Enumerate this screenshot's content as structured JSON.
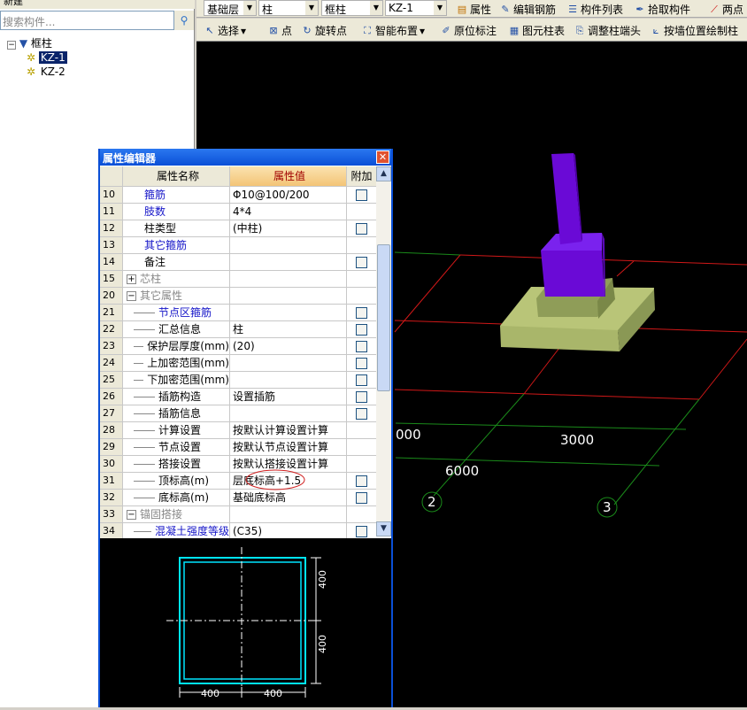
{
  "left_panel": {
    "toolbar_new": "新建",
    "search_placeholder": "搜索构件...",
    "tree": {
      "root": "框柱",
      "children": [
        "KZ-1",
        "KZ-2"
      ],
      "selected": "KZ-1"
    }
  },
  "toolbar1": {
    "floor": "基础层",
    "category": "柱",
    "type": "框柱",
    "component": "KZ-1",
    "buttons": [
      "属性",
      "编辑钢筋",
      "构件列表",
      "拾取构件",
      "两点"
    ]
  },
  "toolbar2": {
    "buttons": [
      "选择",
      "点",
      "旋转点",
      "智能布置",
      "原位标注",
      "图元柱表",
      "调整柱端头",
      "按墙位置绘制柱"
    ]
  },
  "scene": {
    "labels": [
      "000",
      "3000",
      "6000"
    ],
    "axes": [
      "2",
      "3"
    ],
    "column_color": "#6a0ad6",
    "footing_color": "#a9b66a"
  },
  "editor": {
    "title": "属性编辑器",
    "headers": [
      "属性名称",
      "属性值",
      "附加"
    ],
    "rows": [
      {
        "n": "10",
        "name": "箍筋",
        "value": "Φ10@100/200",
        "style": "blue",
        "cb": true
      },
      {
        "n": "11",
        "name": "肢数",
        "value": "4*4",
        "style": "blue",
        "cb": false
      },
      {
        "n": "12",
        "name": "柱类型",
        "value": "(中柱)",
        "style": "",
        "cb": true
      },
      {
        "n": "13",
        "name": "其它箍筋",
        "value": "",
        "style": "blue",
        "cb": false
      },
      {
        "n": "14",
        "name": "备注",
        "value": "",
        "style": "",
        "cb": true
      },
      {
        "n": "15",
        "name": "芯柱",
        "value": "",
        "style": "gray",
        "exp": "+",
        "cb": false
      },
      {
        "n": "20",
        "name": "其它属性",
        "value": "",
        "style": "gray",
        "exp": "−",
        "cb": false
      },
      {
        "n": "21",
        "name": "节点区箍筋",
        "value": "",
        "style": "blue",
        "child": true,
        "cb": true
      },
      {
        "n": "22",
        "name": "汇总信息",
        "value": "柱",
        "style": "",
        "child": true,
        "cb": true
      },
      {
        "n": "23",
        "name": "保护层厚度(mm)",
        "value": "(20)",
        "style": "",
        "child": true,
        "cb": true
      },
      {
        "n": "24",
        "name": "上加密范围(mm)",
        "value": "",
        "style": "",
        "child": true,
        "cb": true
      },
      {
        "n": "25",
        "name": "下加密范围(mm)",
        "value": "",
        "style": "",
        "child": true,
        "cb": true
      },
      {
        "n": "26",
        "name": "插筋构造",
        "value": "设置插筋",
        "style": "",
        "child": true,
        "cb": true
      },
      {
        "n": "27",
        "name": "插筋信息",
        "value": "",
        "style": "",
        "child": true,
        "cb": true
      },
      {
        "n": "28",
        "name": "计算设置",
        "value": "按默认计算设置计算",
        "style": "",
        "child": true,
        "cb": false
      },
      {
        "n": "29",
        "name": "节点设置",
        "value": "按默认节点设置计算",
        "style": "",
        "child": true,
        "cb": false
      },
      {
        "n": "30",
        "name": "搭接设置",
        "value": "按默认搭接设置计算",
        "style": "",
        "child": true,
        "cb": false
      },
      {
        "n": "31",
        "name": "顶标高(m)",
        "value": "层底标高+1.5",
        "style": "",
        "child": true,
        "cb": true
      },
      {
        "n": "32",
        "name": "底标高(m)",
        "value": "基础底标高",
        "style": "",
        "child": true,
        "cb": true
      },
      {
        "n": "33",
        "name": "锚固搭接",
        "value": "",
        "style": "gray",
        "exp": "−",
        "cb": false
      },
      {
        "n": "34",
        "name": "混凝土强度等级",
        "value": "(C35)",
        "style": "blue",
        "child": true,
        "cb": true
      }
    ],
    "section": {
      "dims": [
        "400",
        "400",
        "400",
        "400"
      ],
      "color": "#00e5ff"
    }
  }
}
